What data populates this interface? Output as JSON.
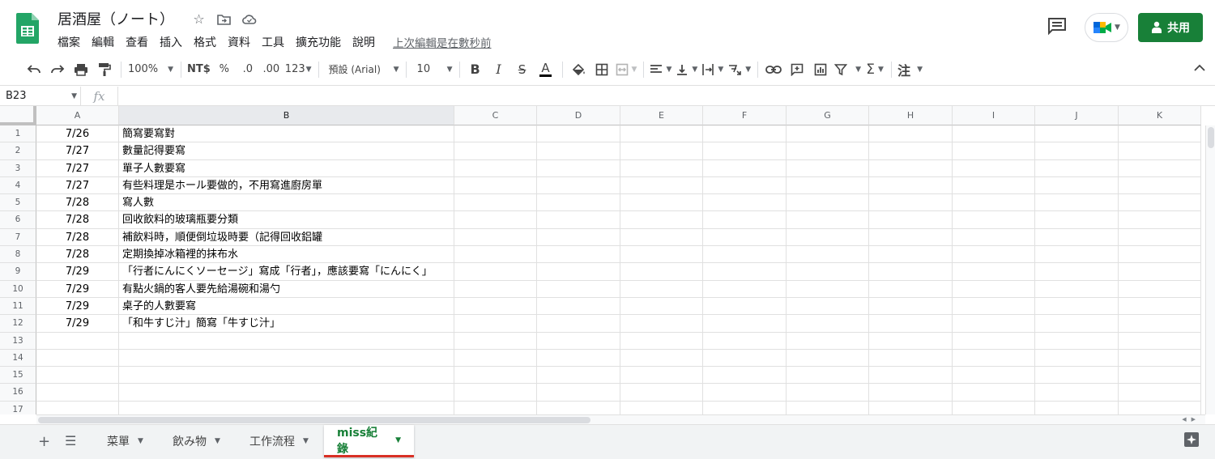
{
  "document": {
    "title": "居酒屋（ノート）",
    "menu": [
      "檔案",
      "編輯",
      "查看",
      "插入",
      "格式",
      "資料",
      "工具",
      "擴充功能",
      "說明"
    ],
    "last_edit": "上次編輯是在數秒前",
    "share_label": "共用"
  },
  "toolbar": {
    "zoom": "100%",
    "currency": "NT$",
    "percent": "%",
    "decrease_decimal": ".0",
    "increase_decimal": ".00",
    "more_formats": "123",
    "font": "預設 (Arial)",
    "font_size": "10",
    "bold": "B",
    "italic": "I",
    "strike": "S",
    "text_color": "A",
    "input_tools": "注"
  },
  "formula_bar": {
    "cell_ref": "B23",
    "fx": "fx",
    "content": ""
  },
  "grid": {
    "columns": [
      "A",
      "B",
      "C",
      "D",
      "E",
      "F",
      "G",
      "H",
      "I",
      "J",
      "K"
    ],
    "selected_column": "B",
    "rows": [
      {
        "n": "1",
        "a": "7/26",
        "b": "簡寫要寫對"
      },
      {
        "n": "2",
        "a": "7/27",
        "b": "數量記得要寫"
      },
      {
        "n": "3",
        "a": "7/27",
        "b": "單子人數要寫"
      },
      {
        "n": "4",
        "a": "7/27",
        "b": "有些料理是ホール要做的，不用寫進廚房單"
      },
      {
        "n": "5",
        "a": "7/28",
        "b": "寫人數"
      },
      {
        "n": "6",
        "a": "7/28",
        "b": "回收飲料的玻璃瓶要分類"
      },
      {
        "n": "7",
        "a": "7/28",
        "b": "補飲料時，順便倒垃圾時要（記得回收鋁罐"
      },
      {
        "n": "8",
        "a": "7/28",
        "b": "定期換掉冰箱裡的抹布水"
      },
      {
        "n": "9",
        "a": "7/29",
        "b": "「行者にんにくソーセージ」寫成「行者」，應該要寫「にんにく」"
      },
      {
        "n": "10",
        "a": "7/29",
        "b": "有點火鍋的客人要先給湯碗和湯勺"
      },
      {
        "n": "11",
        "a": "7/29",
        "b": "桌子的人數要寫"
      },
      {
        "n": "12",
        "a": "7/29",
        "b": "「和牛すじ汁」簡寫「牛すじ汁」"
      },
      {
        "n": "13",
        "a": "",
        "b": ""
      },
      {
        "n": "14",
        "a": "",
        "b": ""
      },
      {
        "n": "15",
        "a": "",
        "b": ""
      },
      {
        "n": "16",
        "a": "",
        "b": ""
      },
      {
        "n": "17",
        "a": "",
        "b": ""
      }
    ]
  },
  "sheets": {
    "tabs": [
      {
        "label": "菜單",
        "active": false
      },
      {
        "label": "飲み物",
        "active": false
      },
      {
        "label": "工作流程",
        "active": false
      },
      {
        "label": "miss紀錄",
        "active": true
      }
    ]
  },
  "colors": {
    "brand_green": "#188038",
    "active_tab_underline": "#d93025",
    "header_bg": "#f8f9fa"
  },
  "icons": [
    "star-icon",
    "move-to-folder-icon",
    "cloud-status-icon",
    "comment-history-icon",
    "meet-icon",
    "share-person-icon",
    "undo-icon",
    "redo-icon",
    "print-icon",
    "paint-format-icon",
    "fill-color-icon",
    "borders-icon",
    "merge-cells-icon",
    "align-icon",
    "vertical-align-icon",
    "text-wrap-icon",
    "text-rotate-icon",
    "link-icon",
    "comment-icon",
    "chart-icon",
    "filter-icon",
    "functions-icon",
    "explore-icon"
  ]
}
